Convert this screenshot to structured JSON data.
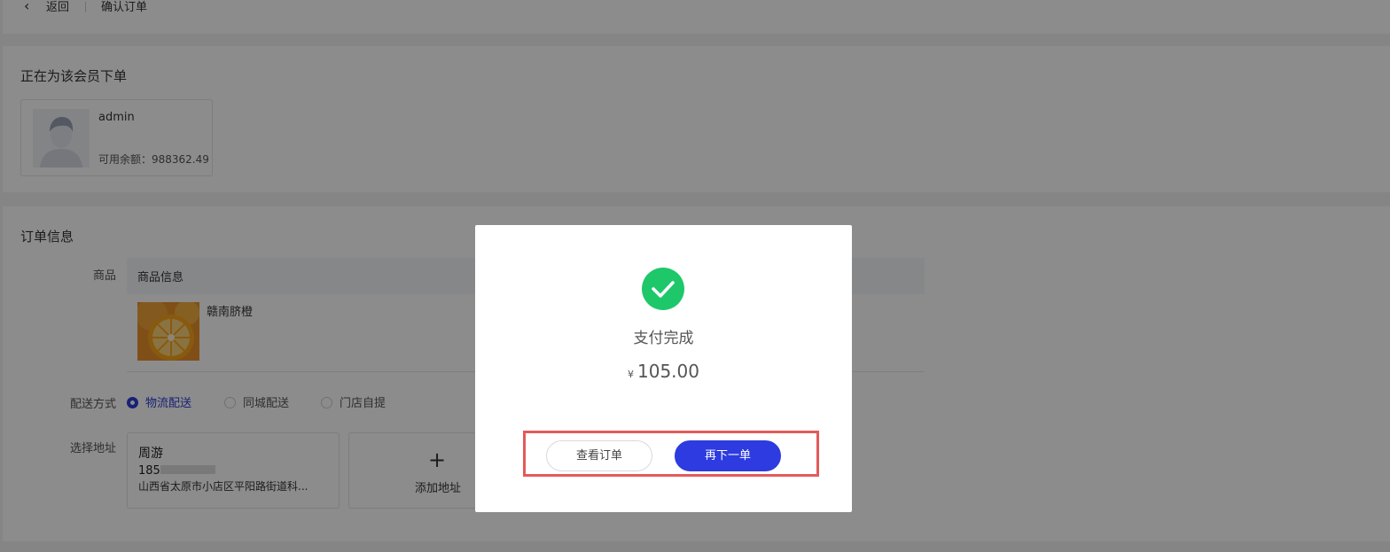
{
  "topbar": {
    "back_label": "返回",
    "title": "确认订单"
  },
  "member": {
    "section_title": "正在为该会员下单",
    "name": "admin",
    "balance_text": "可用余额：988362.49"
  },
  "order": {
    "section_title": "订单信息",
    "goods_label": "商品",
    "goods_header": "商品信息",
    "goods_item": {
      "name": "赣南脐橙",
      "image_icon": "orange-image"
    },
    "delivery_label": "配送方式",
    "delivery_options": [
      {
        "label": "物流配送",
        "checked": true
      },
      {
        "label": "同城配送",
        "checked": false
      },
      {
        "label": "门店自提",
        "checked": false
      }
    ],
    "address_label": "选择地址",
    "address": {
      "name": "周游",
      "phone_prefix": "185",
      "detail": "山西省太原市小店区平阳路街道科..."
    },
    "add_address_label": "添加地址"
  },
  "modal": {
    "icon": "check-circle-icon",
    "title": "支付完成",
    "currency": "¥",
    "amount": "105.00",
    "view_order_label": "查看订单",
    "order_again_label": "再下一单",
    "colors": {
      "success": "#1ec86a",
      "primary": "#2d3be0",
      "highlight": "#e45a5a"
    }
  }
}
